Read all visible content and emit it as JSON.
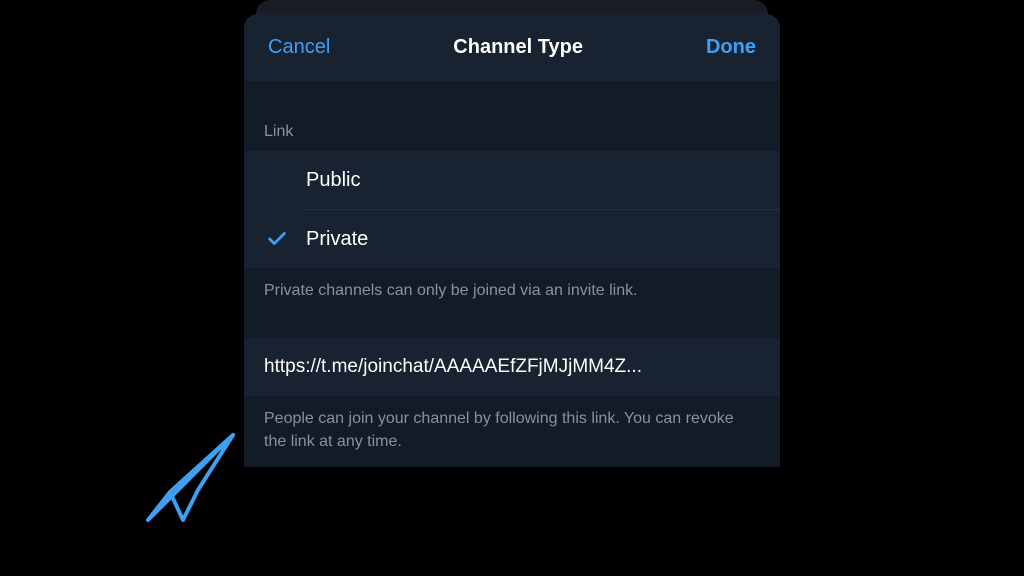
{
  "header": {
    "cancel": "Cancel",
    "title": "Channel Type",
    "done": "Done"
  },
  "section": {
    "label": "Link",
    "options": {
      "public": "Public",
      "private": "Private"
    },
    "selected": "private",
    "description": "Private channels can only be joined via an invite link."
  },
  "invite": {
    "url": "https://t.me/joinchat/AAAAAEfZFjMJjMM4Z...",
    "description": "People can join your channel by following this link. You can revoke the link at any time."
  },
  "colors": {
    "accent": "#3f9ff3",
    "panel": "#182231",
    "panel_dark": "#131b27"
  }
}
